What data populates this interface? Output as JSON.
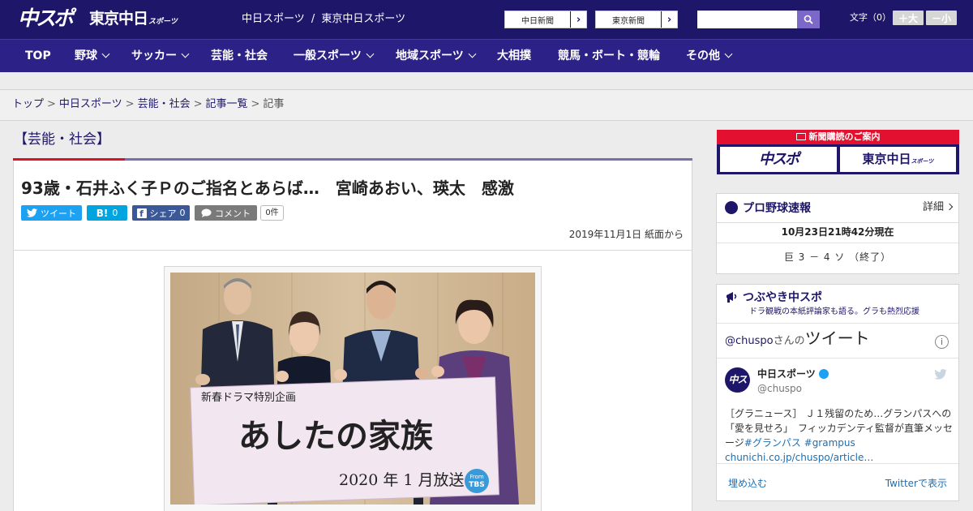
{
  "header": {
    "logo_chuspo": "中スポ",
    "logo_tokyo": "東京中日",
    "logo_tokyo_sub": "スポーツ",
    "site_links": [
      "中日スポーツ",
      "/",
      "東京中日スポーツ"
    ],
    "paper_buttons": [
      "中日新聞",
      "東京新聞"
    ],
    "search_placeholder": "",
    "font_size_label": "文字（0）",
    "font_larger": "＋大",
    "font_smaller": "－小"
  },
  "nav": {
    "items": [
      {
        "label": "TOP"
      },
      {
        "label": "野球"
      },
      {
        "label": "サッカー"
      },
      {
        "label": "芸能・社会"
      },
      {
        "label": "一般スポーツ"
      },
      {
        "label": "地域スポーツ"
      },
      {
        "label": "大相撲"
      },
      {
        "label": "競馬・ボート・競輪"
      },
      {
        "label": "その他"
      }
    ]
  },
  "breadcrumb": {
    "items": [
      "トップ",
      "中日スポーツ",
      "芸能・社会",
      "記事一覧",
      "記事"
    ],
    "separator": ">"
  },
  "article": {
    "section_title": "【芸能・社会】",
    "title": "93歳・石井ふく子Ｐのご指名とあらば…　宮崎あおい、瑛太　感激",
    "share": {
      "tweet": "ツイート",
      "hatena_icon": "B!",
      "hatena_count": "0",
      "facebook": "シェア",
      "facebook_count": "0",
      "comment": "コメント",
      "comment_count": "0件"
    },
    "dateline": "2019年11月1日 紙面から",
    "photo": {
      "banner_sub": "新春ドラマ特別企画",
      "banner_title": "あしたの家族",
      "banner_date": "2020 年 1 月放送",
      "badge_from": "From",
      "badge_tbs": "TBS"
    }
  },
  "sidebar": {
    "subscribe": {
      "header": "新聞購読のご案内",
      "btn_chuspo": "中スポ",
      "btn_tokyo": "東京中日",
      "btn_tokyo_sub": "スポーツ"
    },
    "baseball": {
      "title": "プロ野球速報",
      "detail": "詳細",
      "time": "10月23日21時42分現在",
      "score": "巨 3 － 4 ソ （終了）"
    },
    "tweets": {
      "title": "つぶやき中スポ",
      "subtitle": "ドラ観戦の本紙評論家も語る。グラも熱烈応援",
      "account_prefix": "@chuspo",
      "account_suffix": "さんの",
      "header_big": "ツイート",
      "info": "i",
      "user_name": "中日スポーツ",
      "avatar_text": "中スポ",
      "handle": "@chuspo",
      "text_plain": "［グラニュース］ Ｊ１残留のため…グランパスへの「愛を見せろ」　フィッカデンティ監督が直筆メッセージ",
      "text_tags": "#グランパス #grampus",
      "text_link": "chunichi.co.jp/chuspo/article…",
      "embed": "埋め込む",
      "view_on_twitter": "Twitterで表示"
    }
  },
  "colors": {
    "navy": "#1e1769",
    "nav_purple": "#2c2187",
    "accent_red": "#d7132e",
    "twitter_blue": "#1da1f2",
    "hatena_blue": "#00a4de",
    "facebook_blue": "#3b5998",
    "comment_gray": "#7a7a7a"
  }
}
